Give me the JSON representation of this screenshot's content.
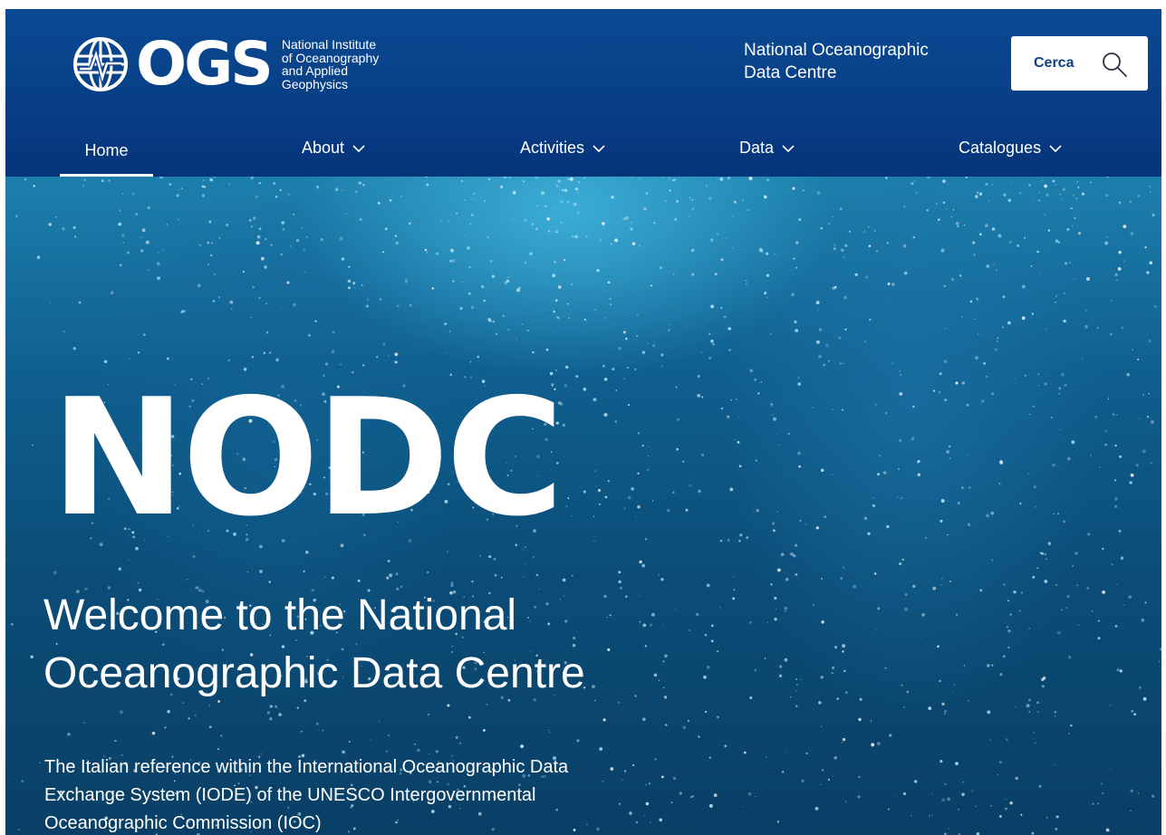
{
  "header": {
    "logo_letters": "OGS",
    "logo_tagline": [
      "National Institute",
      "of Oceanography",
      "and Applied",
      "Geophysics"
    ],
    "centre_name": [
      "National Oceanographic",
      "Data Centre"
    ],
    "search_label": "Cerca",
    "colors": {
      "header_blue": "#083f86",
      "search_text": "#0c3f86"
    }
  },
  "nav": {
    "items": [
      {
        "label": "Home",
        "active": true
      },
      {
        "label": "About",
        "dropdown": true
      },
      {
        "label": "Activities",
        "dropdown": true
      },
      {
        "label": "Data",
        "dropdown": true
      },
      {
        "label": "Catalogues",
        "dropdown": true
      }
    ]
  },
  "hero": {
    "title": "NODC",
    "subtitle": [
      "Welcome to the National",
      "Oceanographic Data Centre"
    ],
    "description": [
      "The Italian reference within the International Oceanographic Data",
      "Exchange System (IODE) of the UNESCO Intergovernmental",
      "Oceanographic Commission (IOC)"
    ]
  }
}
